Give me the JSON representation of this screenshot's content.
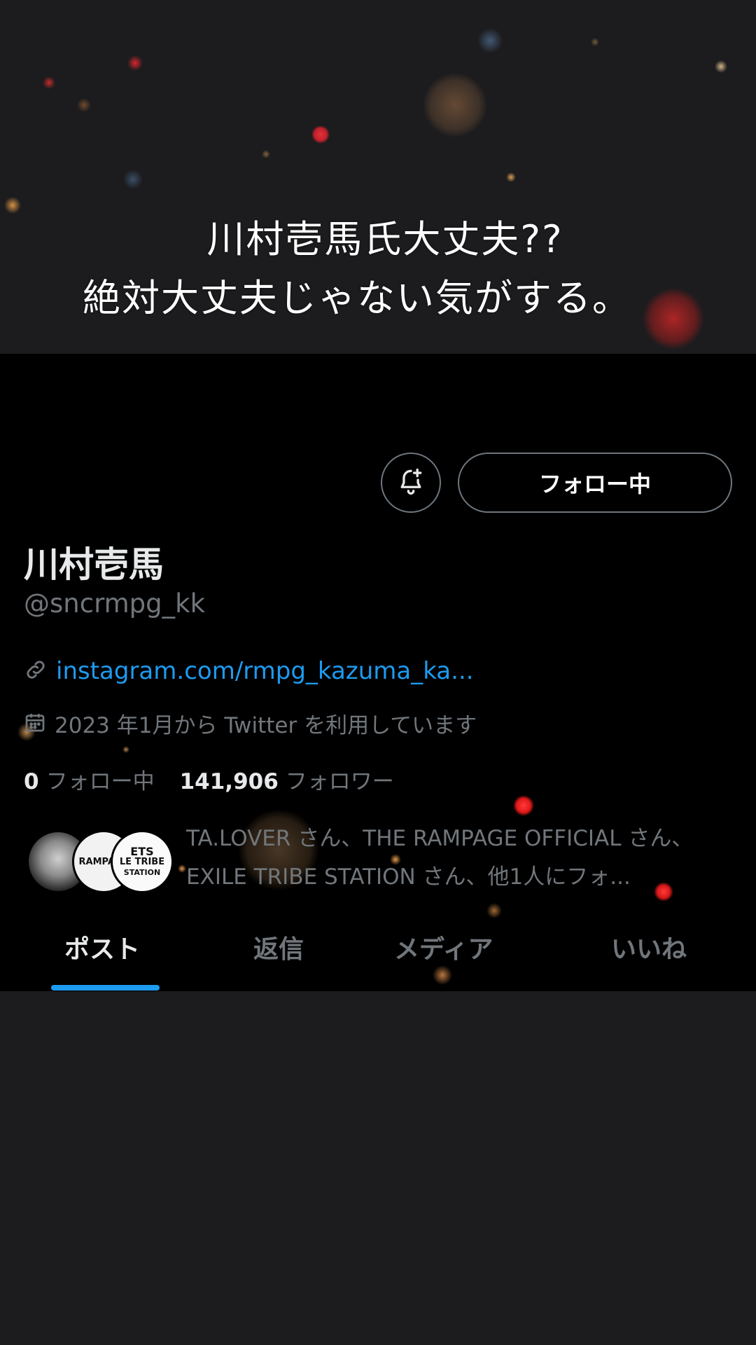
{
  "overlay_caption": {
    "line1": "川村壱馬氏大丈夫??",
    "line2": "絶対大丈夫じゃない気がする。"
  },
  "profile": {
    "name": "川村壱馬",
    "handle": "@sncrmpg_kk",
    "website": "instagram.com/rmpg_kazuma_ka...",
    "joined": "2023 年1月から Twitter を利用しています",
    "following_count": "0",
    "following_label": "フォロー中",
    "followers_count": "141,906",
    "followers_label": "フォロワー",
    "followed_by_text": "TA.LOVER さん、THE RAMPAGE OFFICIAL さん、EXILE TRIBE STATION さん、他1人にフォ...",
    "follow_button_label": "フォロー中",
    "avatar_labels": {
      "rampage": "RAMPAGE",
      "station_top": "ETS",
      "station_mid": "LE TRIBE",
      "station_bot": "STATION"
    }
  },
  "tabs": [
    {
      "label": "ポスト",
      "active": true
    },
    {
      "label": "返信",
      "active": false
    },
    {
      "label": "メディア",
      "active": false
    },
    {
      "label": "いいね",
      "active": false
    }
  ],
  "colors": {
    "accent": "#1d9bf0",
    "secondary_text": "#71767b",
    "primary_text": "#e7e9ea"
  },
  "icons": [
    "bell-plus-icon",
    "link-icon",
    "calendar-icon"
  ]
}
